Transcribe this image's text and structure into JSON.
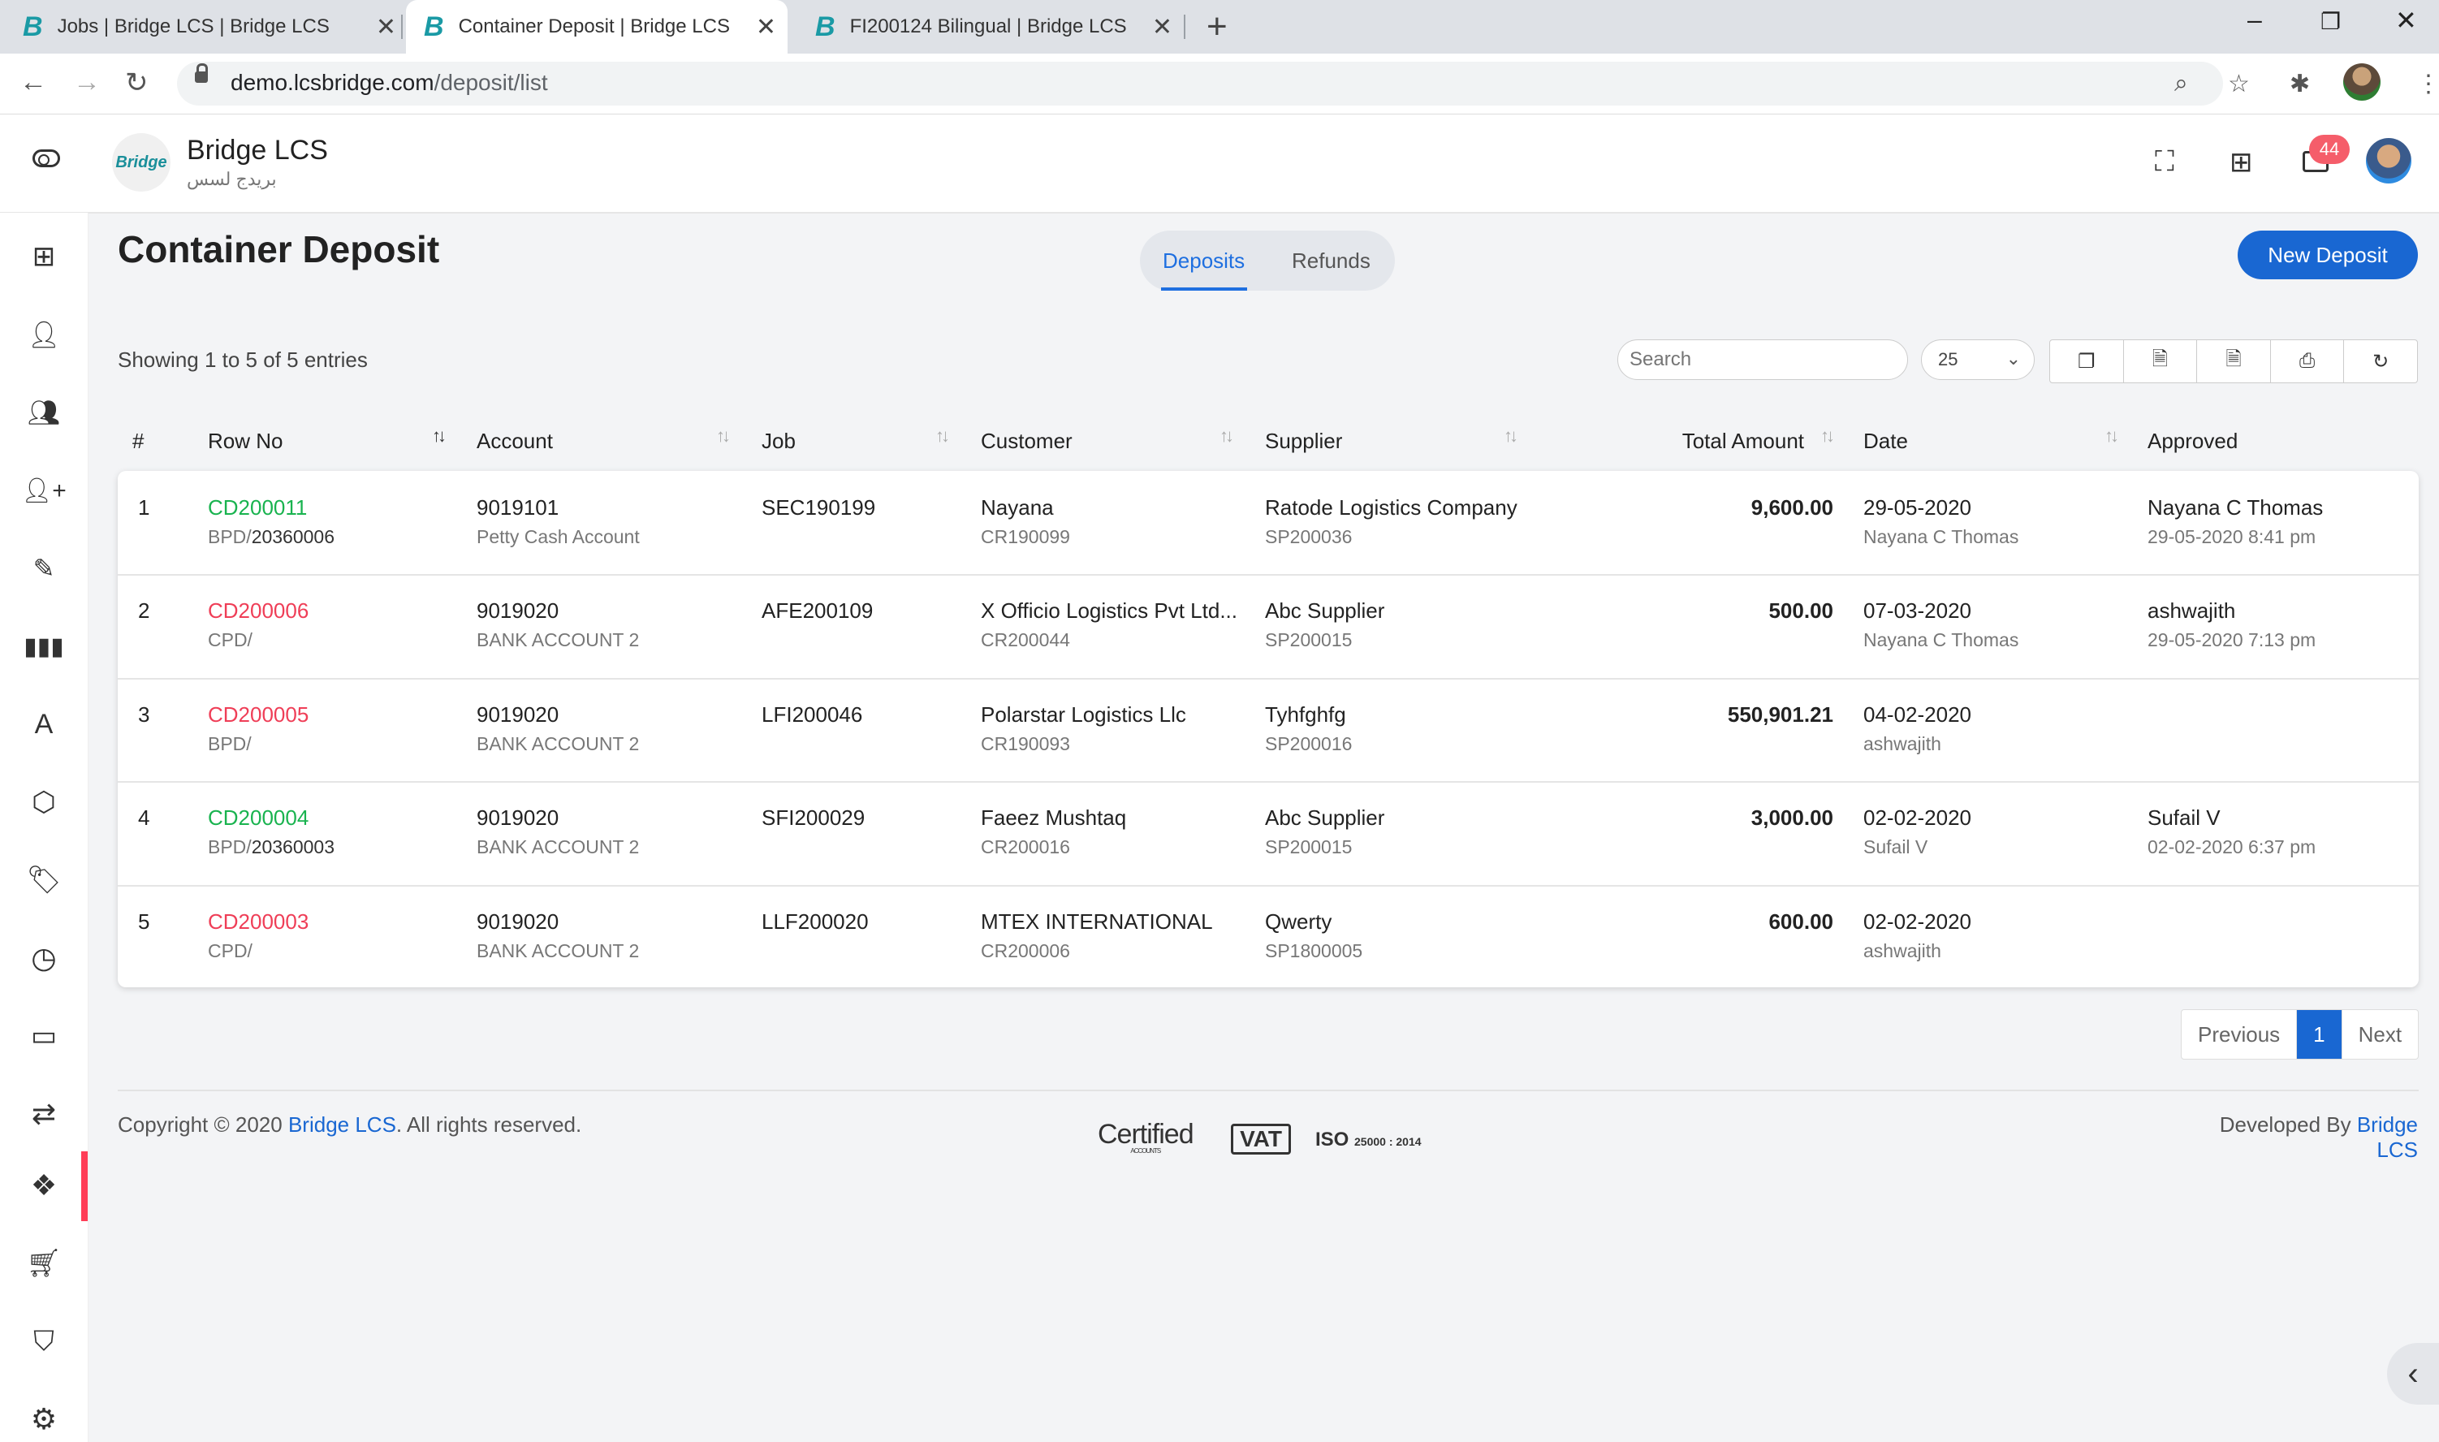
{
  "browser": {
    "tabs": [
      {
        "title": "Jobs | Bridge LCS | Bridge LCS",
        "favicon": "B"
      },
      {
        "title": "Container Deposit | Bridge LCS | B",
        "favicon": "B"
      },
      {
        "title": "FI200124 Bilingual | Bridge LCS",
        "favicon": "B"
      }
    ],
    "url_host": "demo.lcsbridge.com",
    "url_path": "/deposit/list"
  },
  "app": {
    "logo_text": "Bridge",
    "brand": "Bridge LCS",
    "brand_arabic": "بريدج لسس",
    "notification_count": "44"
  },
  "page": {
    "title": "Container Deposit",
    "tabs": [
      "Deposits",
      "Refunds"
    ],
    "new_button": "New Deposit",
    "showing": "Showing 1 to 5 of 5 entries",
    "search_placeholder": "Search",
    "page_length": "25"
  },
  "table": {
    "headers": [
      "#",
      "Row No",
      "Account",
      "Job",
      "Customer",
      "Supplier",
      "Total Amount",
      "Date",
      "Approved"
    ],
    "rows": [
      {
        "n": "1",
        "row_no": "CD200011",
        "row_status": "green",
        "ref_prefix": "BPD/",
        "ref_num": "20360006",
        "account": "9019101",
        "account_name": "Petty Cash Account",
        "job": "SEC190199",
        "customer": "Nayana",
        "customer_code": "CR190099",
        "supplier": "Ratode Logistics Company",
        "supplier_code": "SP200036",
        "amount": "9,600.00",
        "date": "29-05-2020",
        "date_by": "Nayana C Thomas",
        "approved": "Nayana C Thomas",
        "approved_at": "29-05-2020 8:41 pm"
      },
      {
        "n": "2",
        "row_no": "CD200006",
        "row_status": "red",
        "ref_prefix": "CPD/",
        "ref_num": "",
        "account": "9019020",
        "account_name": "BANK ACCOUNT 2",
        "job": "AFE200109",
        "customer": "X Officio Logistics Pvt Ltd...",
        "customer_code": "CR200044",
        "supplier": "Abc Supplier",
        "supplier_code": "SP200015",
        "amount": "500.00",
        "date": "07-03-2020",
        "date_by": "Nayana C Thomas",
        "approved": "ashwajith",
        "approved_at": "29-05-2020 7:13 pm"
      },
      {
        "n": "3",
        "row_no": "CD200005",
        "row_status": "red",
        "ref_prefix": "BPD/",
        "ref_num": "",
        "account": "9019020",
        "account_name": "BANK ACCOUNT 2",
        "job": "LFI200046",
        "customer": "Polarstar Logistics Llc",
        "customer_code": "CR190093",
        "supplier": "Tyhfghfg",
        "supplier_code": "SP200016",
        "amount": "550,901.21",
        "date": "04-02-2020",
        "date_by": "ashwajith",
        "approved": "",
        "approved_at": ""
      },
      {
        "n": "4",
        "row_no": "CD200004",
        "row_status": "green",
        "ref_prefix": "BPD/",
        "ref_num": "20360003",
        "account": "9019020",
        "account_name": "BANK ACCOUNT 2",
        "job": "SFI200029",
        "customer": "Faeez Mushtaq",
        "customer_code": "CR200016",
        "supplier": "Abc Supplier",
        "supplier_code": "SP200015",
        "amount": "3,000.00",
        "date": "02-02-2020",
        "date_by": "Sufail V",
        "approved": "Sufail V",
        "approved_at": "02-02-2020 6:37 pm"
      },
      {
        "n": "5",
        "row_no": "CD200003",
        "row_status": "red",
        "ref_prefix": "CPD/",
        "ref_num": "",
        "account": "9019020",
        "account_name": "BANK ACCOUNT 2",
        "job": "LLF200020",
        "customer": "MTEX INTERNATIONAL",
        "customer_code": "CR200006",
        "supplier": "Qwerty",
        "supplier_code": "SP1800005",
        "amount": "600.00",
        "date": "02-02-2020",
        "date_by": "ashwajith",
        "approved": "",
        "approved_at": ""
      }
    ]
  },
  "pagination": {
    "previous": "Previous",
    "current": "1",
    "next": "Next"
  },
  "footer": {
    "copyright_prefix": "Copyright © 2020 ",
    "copyright_link": "Bridge LCS",
    "copyright_suffix": ". All rights reserved.",
    "developed_prefix": "Developed By ",
    "developed_link": "Bridge LCS",
    "cert_text": "Certified",
    "cert_sub": "ACCOUNTS",
    "vat_text": "VAT",
    "iso_text": "ISO",
    "iso_num": "25000 : 2014"
  },
  "colors": {
    "primary": "#1967d2",
    "green": "#19b34f",
    "red": "#ef3e57",
    "badge": "#f55d6a"
  }
}
